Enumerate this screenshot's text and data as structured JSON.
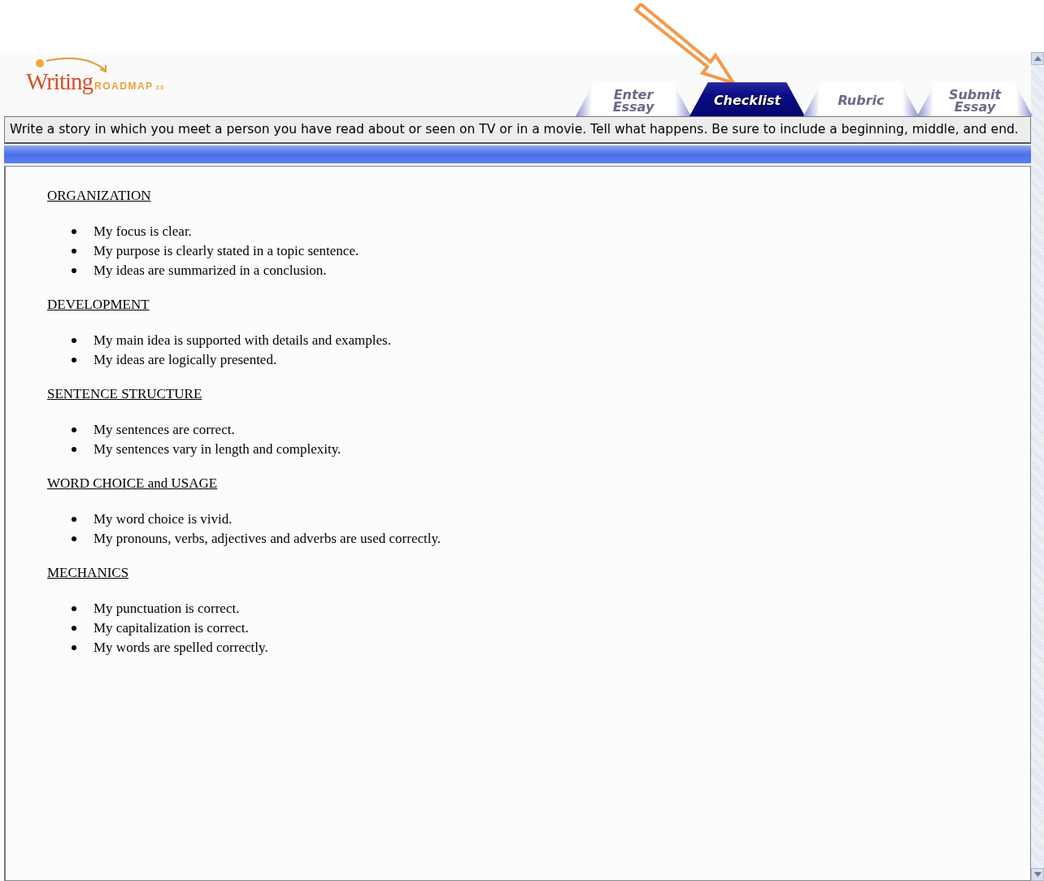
{
  "logo": {
    "word": "Writing",
    "brand": "ROADMAP",
    "version": "2.0"
  },
  "tabs": [
    {
      "label": "Enter Essay",
      "selected": false
    },
    {
      "label": "Checklist",
      "selected": true
    },
    {
      "label": "Rubric",
      "selected": false
    },
    {
      "label": "Submit Essay",
      "selected": false
    }
  ],
  "prompt": "Write a story in which you meet a person you have read about or seen on TV or in a movie. Tell what happens. Be sure to include a beginning, middle, and end.",
  "checklist": [
    {
      "heading": "ORGANIZATION",
      "items": [
        "My focus is clear.",
        "My purpose is clearly stated in a topic sentence.",
        "My ideas are summarized in a conclusion."
      ]
    },
    {
      "heading": "DEVELOPMENT",
      "items": [
        "My main idea is supported with details and examples.",
        "My ideas are logically presented."
      ]
    },
    {
      "heading": "SENTENCE STRUCTURE",
      "items": [
        "My sentences are correct.",
        "My sentences vary in length and complexity."
      ]
    },
    {
      "heading": "WORD CHOICE and USAGE",
      "items": [
        "My word choice is vivid.",
        "My pronouns, verbs, adjectives and adverbs are used correctly."
      ]
    },
    {
      "heading": "MECHANICS",
      "items": [
        "My punctuation is correct.",
        "My capitalization is correct.",
        "My words are spelled correctly."
      ]
    }
  ]
}
